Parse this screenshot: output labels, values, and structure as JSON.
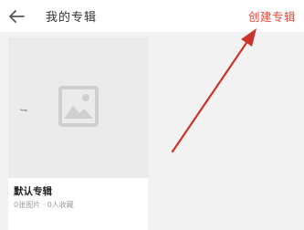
{
  "header": {
    "title": "我的专辑",
    "create_label": "创建专辑"
  },
  "album": {
    "name": "默认专辑",
    "meta": "0张图片 · 0人收藏"
  },
  "colors": {
    "accent": "#e84c3d",
    "annotation_arrow": "#c9352b"
  },
  "icons": {
    "back": "back-arrow-icon",
    "placeholder": "image-placeholder-icon"
  }
}
